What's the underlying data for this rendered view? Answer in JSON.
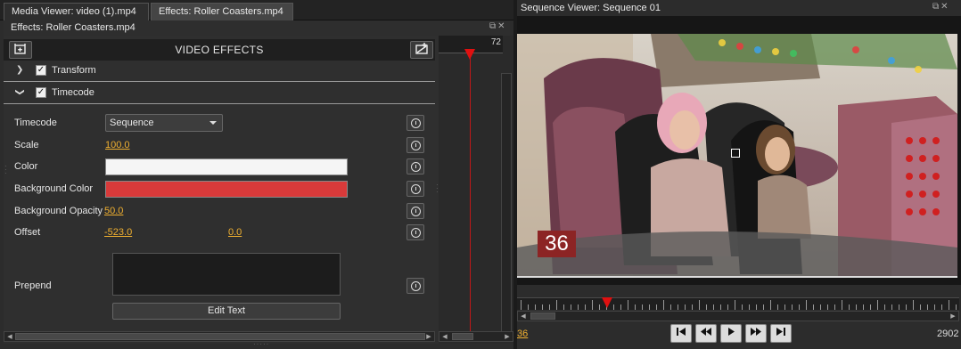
{
  "tabs": [
    {
      "label": "Media Viewer: video (1).mp4"
    },
    {
      "label": "Effects: Roller Coasters.mp4"
    }
  ],
  "effects_panel": {
    "title": "Effects: Roller Coasters.mp4",
    "header": "VIDEO EFFECTS",
    "sections": [
      {
        "label": "Transform",
        "checked": true,
        "expanded": false
      },
      {
        "label": "Timecode",
        "checked": true,
        "expanded": true
      }
    ],
    "params": {
      "timecode": {
        "label": "Timecode",
        "value": "Sequence"
      },
      "scale": {
        "label": "Scale",
        "value": "100.0"
      },
      "color": {
        "label": "Color",
        "value": "#f5f5f5"
      },
      "background_color": {
        "label": "Background Color",
        "value": "#d83a3a"
      },
      "background_opacity": {
        "label": "Background Opacity",
        "value": "50.0"
      },
      "offset": {
        "label": "Offset",
        "x": "-523.0",
        "y": "0.0"
      },
      "prepend": {
        "label": "Prepend",
        "value": ""
      }
    },
    "edit_text_label": "Edit Text"
  },
  "timeline": {
    "ruler_number": "72"
  },
  "sequence_viewer": {
    "title": "Sequence Viewer: Sequence 01",
    "timecode_overlay": "36",
    "current_frame": "36",
    "end_frame": "2902"
  },
  "colors": {
    "accent_link": "#f0b030",
    "playhead": "#e01010"
  },
  "icons": {
    "add_effect": "add-effect-icon",
    "add_transition": "add-transition-icon",
    "keyframe": "stopwatch-icon",
    "transport": [
      "skip-to-start-icon",
      "rewind-icon",
      "play-icon",
      "fast-forward-icon",
      "skip-to-end-icon"
    ]
  }
}
